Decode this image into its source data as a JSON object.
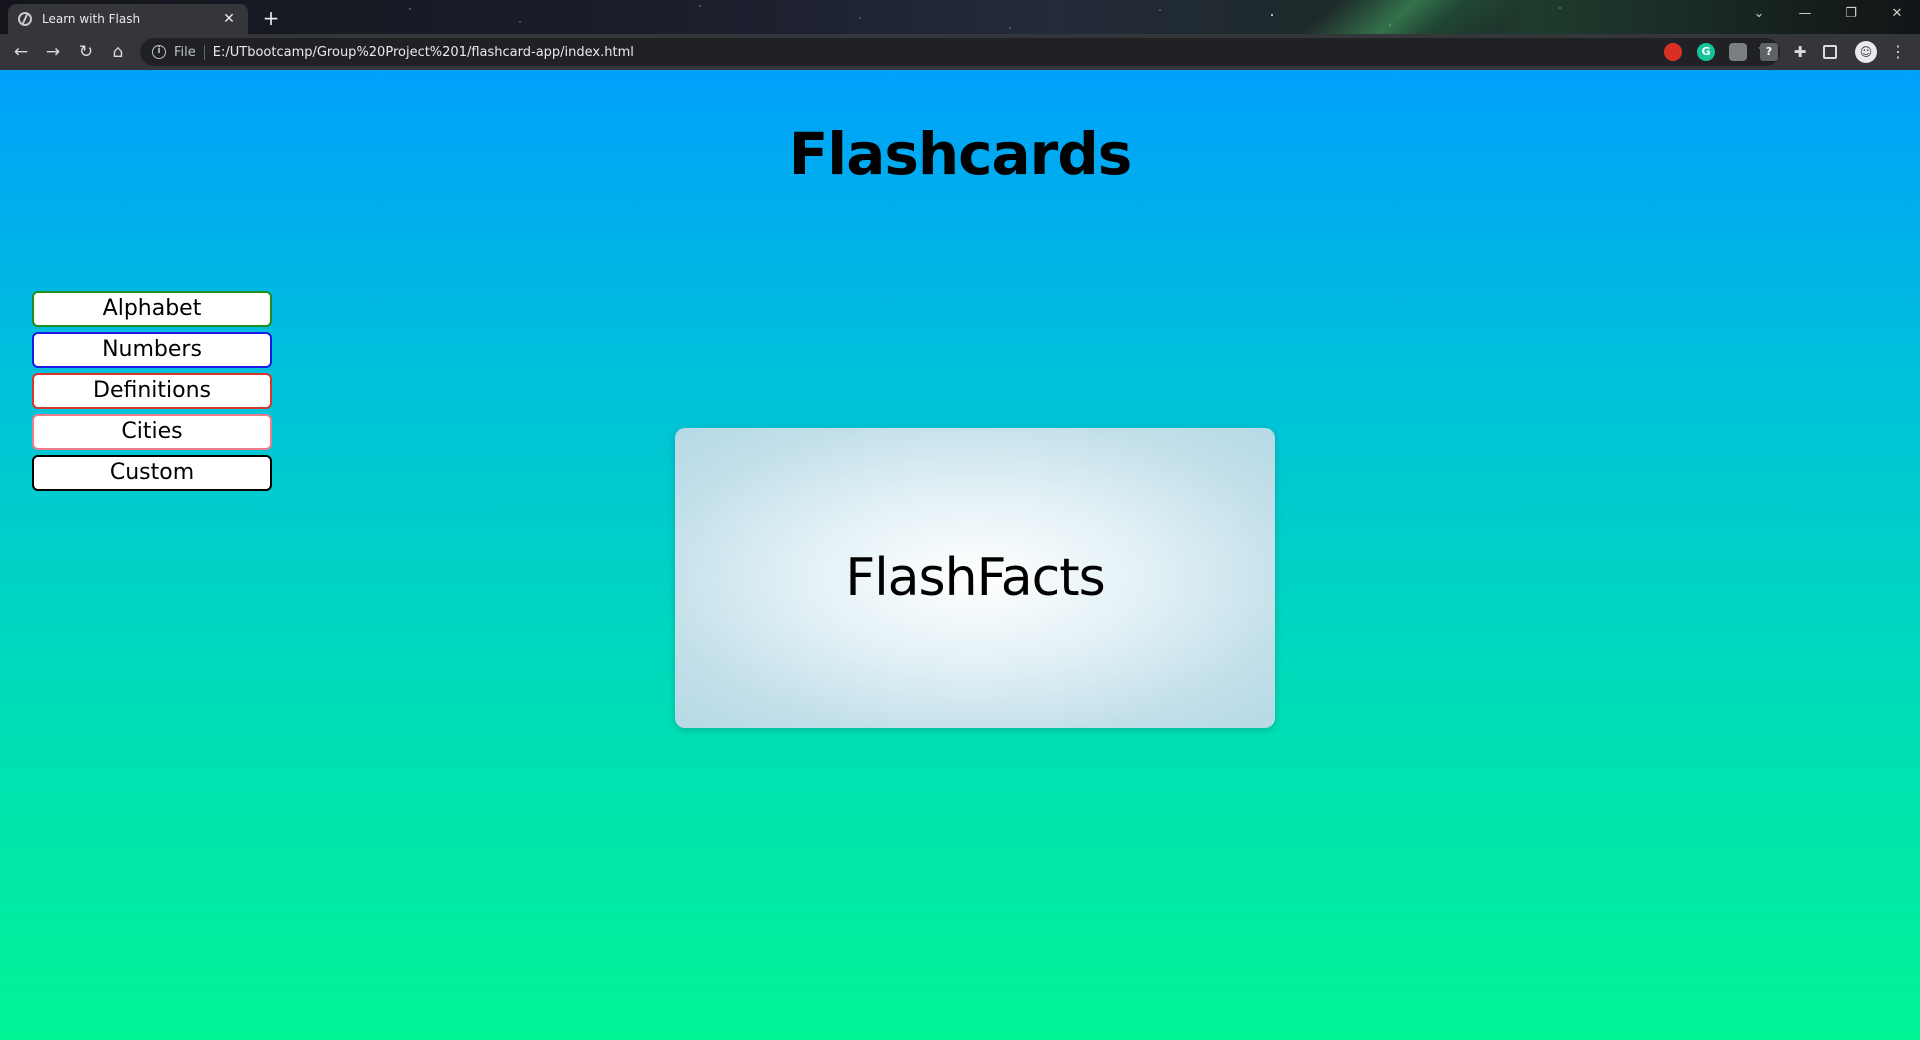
{
  "browser": {
    "tab": {
      "title": "Learn with Flash",
      "close": "✕"
    },
    "new_tab": "+",
    "window_controls": {
      "chevron": "⌄",
      "minimize": "—",
      "maximize": "❐",
      "close": "✕"
    },
    "toolbar": {
      "back": "←",
      "forward": "→",
      "reload": "↻",
      "home": "⌂",
      "file_label": "File",
      "url": "E:/UTbootcamp/Group%20Project%201/flashcard-app/index.html",
      "share": "⇪",
      "bookmark": "☆",
      "puzzle": "✚",
      "kebab": "⋮"
    },
    "extensions": {
      "grammarly": "G",
      "help": "?"
    }
  },
  "page": {
    "title": "Flashcards",
    "topics": [
      {
        "label": "Alphabet",
        "border_color": "#1e8f1e"
      },
      {
        "label": "Numbers",
        "border_color": "#1a1ae6"
      },
      {
        "label": "Definitions",
        "border_color": "#d9362c"
      },
      {
        "label": "Cities",
        "border_color": "#f07a8a"
      },
      {
        "label": "Custom",
        "border_color": "#000000"
      }
    ],
    "card": {
      "text": "FlashFacts"
    }
  },
  "colors": {
    "gradient_top": "#00a0fb",
    "gradient_bottom": "#00f495",
    "card_center": "#ffffff",
    "card_edge": "#b5d9e5"
  }
}
